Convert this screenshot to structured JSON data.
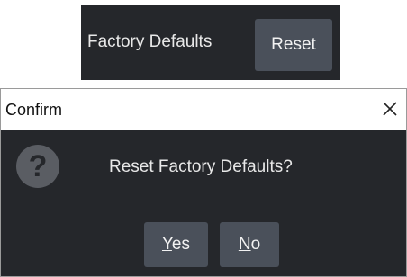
{
  "settings": {
    "label": "Factory Defaults",
    "reset_button": "Reset"
  },
  "dialog": {
    "title": "Confirm",
    "close_glyph": "✕",
    "icon": "question-icon",
    "icon_glyph": "?",
    "message": "Reset Factory Defaults?",
    "yes_mnemonic": "Y",
    "yes_rest": "es",
    "no_mnemonic": "N",
    "no_rest": "o"
  },
  "colors": {
    "panel_bg": "#25272b",
    "button_bg": "#4a505a",
    "text": "#e8e8e8",
    "titlebar_bg": "#ffffff"
  }
}
